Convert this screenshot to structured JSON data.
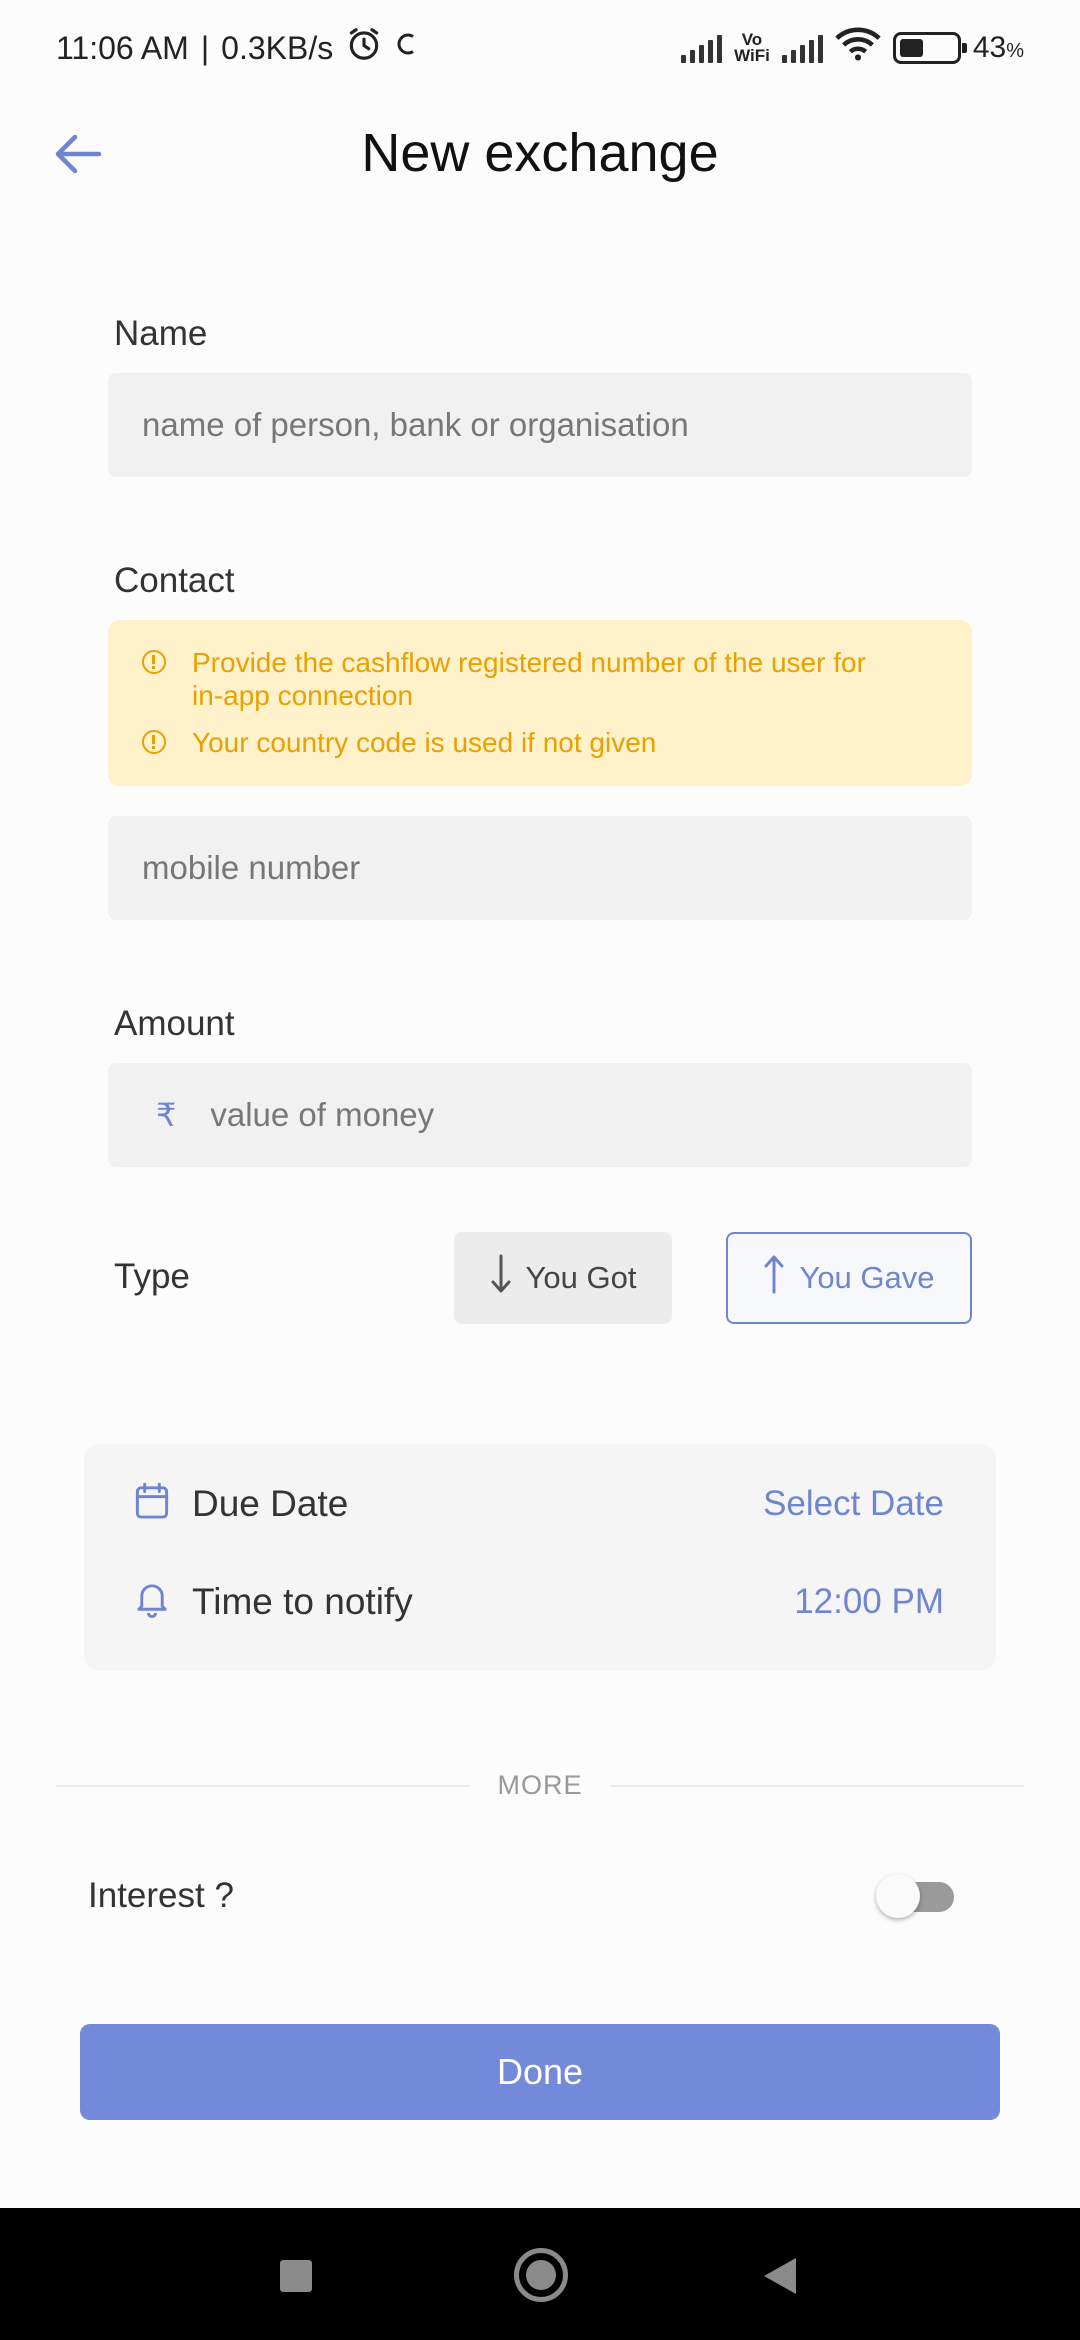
{
  "status_bar": {
    "time": "11:06 AM",
    "net_speed": "0.3KB/s",
    "vowifi_top": "Vo",
    "vowifi_bottom": "WiFi",
    "battery_text": "43",
    "battery_unit": "%",
    "battery_level": 0.43
  },
  "header": {
    "title": "New exchange"
  },
  "name_field": {
    "label": "Name",
    "placeholder": "name of person, bank or organisation"
  },
  "contact_field": {
    "label": "Contact",
    "info": [
      "Provide the cashflow registered number of the user for in-app connection",
      "Your country code is used if not given"
    ],
    "placeholder": "mobile number"
  },
  "amount_field": {
    "label": "Amount",
    "currency_symbol": "₹",
    "placeholder": "value of money"
  },
  "type_field": {
    "label": "Type",
    "got_label": "You Got",
    "gave_label": "You Gave",
    "selected": "You Gave"
  },
  "schedule": {
    "due_date_label": "Due Date",
    "due_date_value": "Select Date",
    "notify_label": "Time to notify",
    "notify_value": "12:00 PM"
  },
  "more": {
    "divider_label": "MORE",
    "interest_label": "Interest ?",
    "interest_enabled": false
  },
  "actions": {
    "done_label": "Done"
  },
  "colors": {
    "accent": "#6f86cf",
    "button": "#7389da",
    "warning": "#e8a100",
    "warning_bg": "#fff1c9"
  }
}
